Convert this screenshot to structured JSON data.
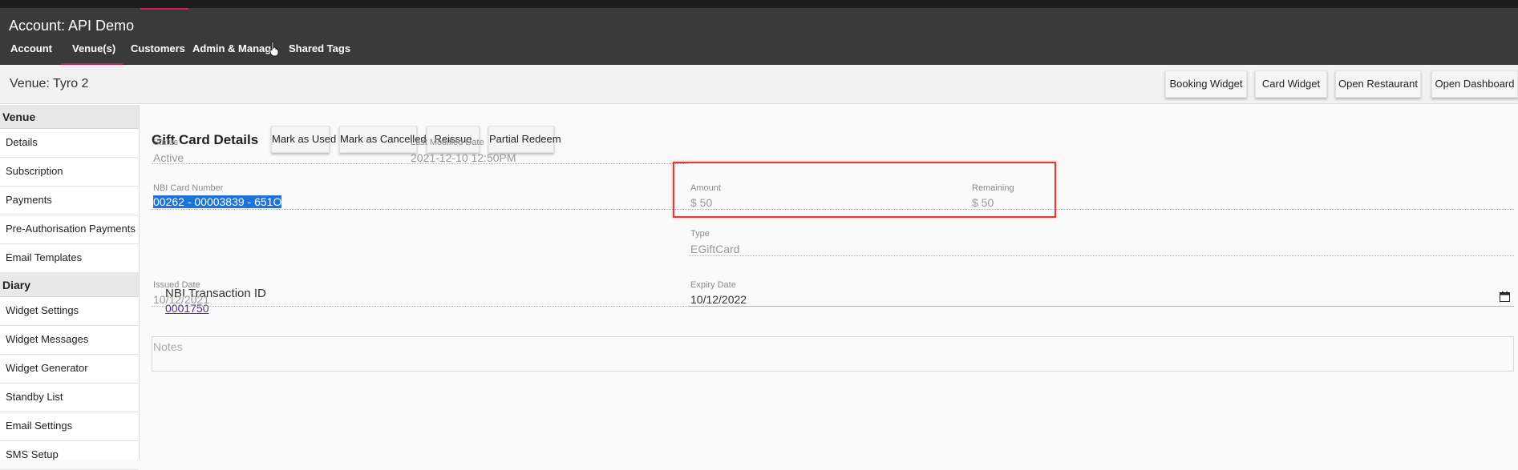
{
  "header": {
    "account_title": "Account: API Demo",
    "tabs": [
      {
        "label": "Account"
      },
      {
        "label": "Venue(s)"
      },
      {
        "label": "Customers"
      },
      {
        "label": "Admin & Manage"
      },
      {
        "label": "Shared Tags"
      }
    ],
    "active_tab": "Venue(s)"
  },
  "venue_bar": {
    "title": "Venue: Tyro 2",
    "buttons": [
      "Booking Widget",
      "Card Widget",
      "Open Restaurant",
      "Open Dashboard"
    ]
  },
  "sidebar": {
    "venue_heading": "Venue",
    "venue_items": [
      "Details",
      "Subscription",
      "Payments",
      "Pre-Authorisation Payments",
      "Email Templates"
    ],
    "diary_heading": "Diary",
    "diary_items": [
      "Widget Settings",
      "Widget Messages",
      "Widget Generator",
      "Standby List",
      "Email Settings",
      "SMS Setup"
    ]
  },
  "gift_card": {
    "title": "Gift Card Details",
    "actions": [
      "Mark as Used",
      "Mark as Cancelled",
      "Reissue",
      "Partial Redeem"
    ],
    "status": {
      "label": "Status",
      "value": "Active"
    },
    "last_modified": {
      "label": "Last Modified Date",
      "value": "2021-12-10 12:50PM"
    },
    "card_number": {
      "label": "NBI Card Number",
      "value": "00262 - 00003839 - 651O"
    },
    "amount": {
      "label": "Amount",
      "value": "$ 50"
    },
    "remaining": {
      "label": "Remaining",
      "value": "$ 50"
    },
    "transaction": {
      "label": "NBI Transaction ID",
      "value": "0001750"
    },
    "type": {
      "label": "Type",
      "value": "EGiftCard"
    },
    "issued": {
      "label": "Issued Date",
      "value": "10/12/2021"
    },
    "expiry": {
      "label": "Expiry Date",
      "value": "10/12/2022"
    },
    "notes_placeholder": "Notes"
  },
  "colors": {
    "topbar": "#3a3a3a",
    "accent": "#d81b60",
    "highlight_box": "#e53935",
    "selection": "#1e73d8",
    "link": "#5b2a86"
  }
}
